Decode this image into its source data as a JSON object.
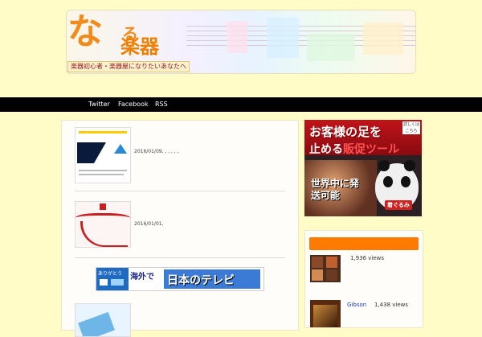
{
  "header": {
    "logo_main": "な",
    "logo_small": "る",
    "logo_sub": "楽器",
    "tagline": "楽器初心者・楽器屋になりたいあなたへ"
  },
  "nav": {
    "items": [
      {
        "label": "Twitter"
      },
      {
        "label": "Facebook"
      },
      {
        "label": "RSS"
      }
    ]
  },
  "posts": [
    {
      "date": "2016/01/09, , , , , ,"
    },
    {
      "date": "2016/01/01,"
    },
    {
      "date": ""
    }
  ],
  "ad_tv": {
    "left_text": "ありがとう",
    "text_main": "海外で",
    "text_highlight": "日本のテレビ"
  },
  "side_ad": {
    "line1": "お客様の足を",
    "line2_a": "止める",
    "line2_b": "販促ツール",
    "line3": "世界中に発送可能",
    "badge": "着ぐるみ",
    "corner": "詳しくはこちら"
  },
  "popular": {
    "items": [
      {
        "name": "",
        "views": "1,936 views"
      },
      {
        "name": "Gibson",
        "views": "1,438 views"
      }
    ]
  },
  "colors": {
    "page_bg": "#fffcc8",
    "nav_bg": "#000000",
    "accent_orange": "#ff7a00",
    "logo_orange": "#f28a1c"
  }
}
